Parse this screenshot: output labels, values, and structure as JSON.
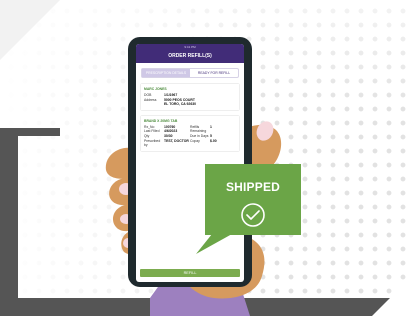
{
  "phone": {
    "status_bar": "9:41 PM",
    "app_title": "ORDER REFILL(S)",
    "tabs": [
      {
        "label": "PRESCRIPTION DETAILS",
        "active": true
      },
      {
        "label": "READY FOR REFILL",
        "active": false
      }
    ],
    "patient": {
      "name": "MARC JONES",
      "dob_label": "DOB",
      "dob": "1/1/1967",
      "address_label": "Address",
      "address_line1": "5000 PEOS COURT",
      "address_line2": "EL TORO, CA 92630"
    },
    "drug": {
      "title": "BRAND X 20MG TAB",
      "left": [
        {
          "label": "Rx_No",
          "value": "100760"
        },
        {
          "label": "Last Filled",
          "value": "4/6/2023"
        },
        {
          "label": "Qty",
          "value": "30/30"
        },
        {
          "label": "Prescribed by",
          "value": "TEST, DOCTOR"
        }
      ],
      "right": [
        {
          "label": "Refills Remaining",
          "value": "1"
        },
        {
          "label": "Due in Days",
          "value": "5"
        },
        {
          "label": "Copay",
          "value": "$.00"
        }
      ]
    },
    "refill_button": "REFILL"
  },
  "badge": {
    "label": "SHIPPED",
    "icon": "check-circle-icon"
  },
  "colors": {
    "app_header": "#412c78",
    "badge_green": "#6ba547",
    "skin": "#d69a5e",
    "sleeve": "#9d80bf"
  }
}
